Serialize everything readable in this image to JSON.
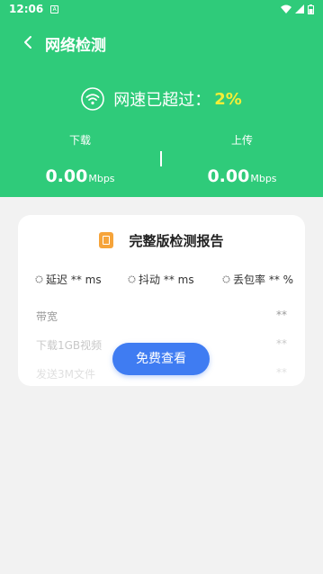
{
  "status_bar": {
    "time": "12:06",
    "notification_glyph": "A"
  },
  "header": {
    "title": "网络检测",
    "speed_label": "网速已超过：",
    "speed_value": "2%",
    "download": {
      "label": "下载",
      "value": "0.00",
      "unit": "Mbps"
    },
    "upload": {
      "label": "上传",
      "value": "0.00",
      "unit": "Mbps"
    }
  },
  "report": {
    "title": "完整版检测报告",
    "stats": [
      {
        "label": "延迟 ** ms"
      },
      {
        "label": "抖动 ** ms"
      },
      {
        "label": "丢包率 ** %"
      }
    ],
    "rows": [
      {
        "label": "带宽",
        "value": "**"
      },
      {
        "label": "下载1GB视频",
        "value": "**"
      },
      {
        "label": "发送3M文件",
        "value": "**"
      }
    ]
  },
  "cta_label": "免费查看",
  "colors": {
    "header_green": "#2fcb7a",
    "speed_highlight": "#f4ee37",
    "cta_blue": "#3f7cf2",
    "report_icon_orange": "#f6a43a"
  }
}
